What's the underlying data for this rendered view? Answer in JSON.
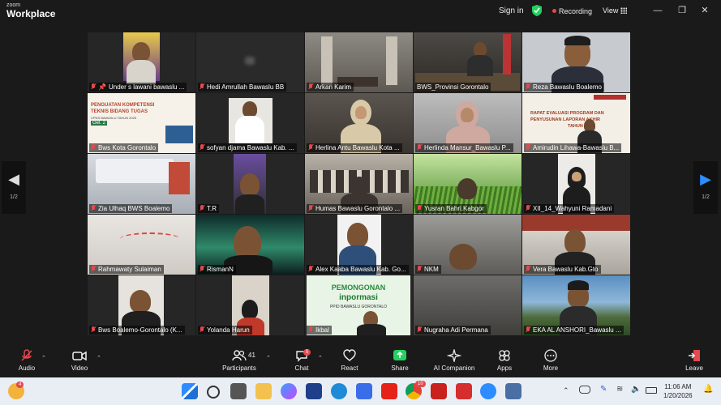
{
  "app": {
    "brand_top": "zoom",
    "brand_name": "Workplace"
  },
  "header": {
    "sign_in": "Sign in",
    "recording": "Recording",
    "view": "View"
  },
  "nav": {
    "page_left": "1/2",
    "page_right": "1/2"
  },
  "participants": [
    {
      "name": "Under s lawani bawaslu ...",
      "pinned": true
    },
    {
      "name": "Hedi Amrullah Bawaslu BB"
    },
    {
      "name": "Arkan Karim"
    },
    {
      "name": "BWS_Provinsi Gorontalo",
      "active": true
    },
    {
      "name": "Reza Bawaslu Boalemo"
    },
    {
      "name": "Bws Kota Gorontalo"
    },
    {
      "name": "sofyan djama Bawaslu Kab. ..."
    },
    {
      "name": "Herlina Antu Bawaslu Kota ..."
    },
    {
      "name": "Herlinda Mansur_Bawaslu P..."
    },
    {
      "name": "Amirudin Lihawa-Bawaslu B..."
    },
    {
      "name": "Zia Ulhaq BWS Boalemo"
    },
    {
      "name": "T.R"
    },
    {
      "name": "Humas Bawaslu Gorontalo ..."
    },
    {
      "name": "Yusran Bahri.Kabgor"
    },
    {
      "name": "XII_14_Wahyuni Ramadani"
    },
    {
      "name": "Rahmawaty Sulaiman"
    },
    {
      "name": "RismanN"
    },
    {
      "name": "Alex Kaaba Bawaslu Kab. Go..."
    },
    {
      "name": "NKM"
    },
    {
      "name": "Vera Bawaslu Kab.Gto"
    },
    {
      "name": "Bws Boalemo-Gorontalo (K..."
    },
    {
      "name": "Yolanda Harun"
    },
    {
      "name": "Ikbal"
    },
    {
      "name": "Nugraha Adi Permana"
    },
    {
      "name": "EKA AL ANSHORI_Bawaslu ..."
    }
  ],
  "slides": {
    "t6_line1": "PENGUATAN KOMPETENSI",
    "t6_line2": "TEKNIS BIDANG TUGAS",
    "t6_line3": "CPNS BAWASLU TAHUN 2025",
    "t6_badge": "Gel. 2",
    "t10_line1": "RAPAT EVALUASI PROGRAM DAN",
    "t10_line2": "PENYUSUNAN LAPORAN AKHIR",
    "t10_line3": "TAHUN",
    "t23_line1": "PEMONGONAN",
    "t23_line2": "inpormasi",
    "t23_line3": "PPID BAWASLU GORONTALO"
  },
  "toolbar": {
    "audio": "Audio",
    "video": "Video",
    "participants": "Participants",
    "participants_count": "41",
    "chat": "Chat",
    "chat_badge": "5",
    "react": "React",
    "share": "Share",
    "ai_companion": "AI Companion",
    "apps": "Apps",
    "more": "More",
    "leave": "Leave"
  },
  "taskbar": {
    "time": "11:06 AM",
    "date": "1/20/2026",
    "weather_badge": "4",
    "chrome_badge": "10"
  },
  "colors": {
    "active_border": "#23d160",
    "share_green": "#23d160",
    "recording_red": "#e5484d",
    "leave_red": "#e5484d"
  }
}
